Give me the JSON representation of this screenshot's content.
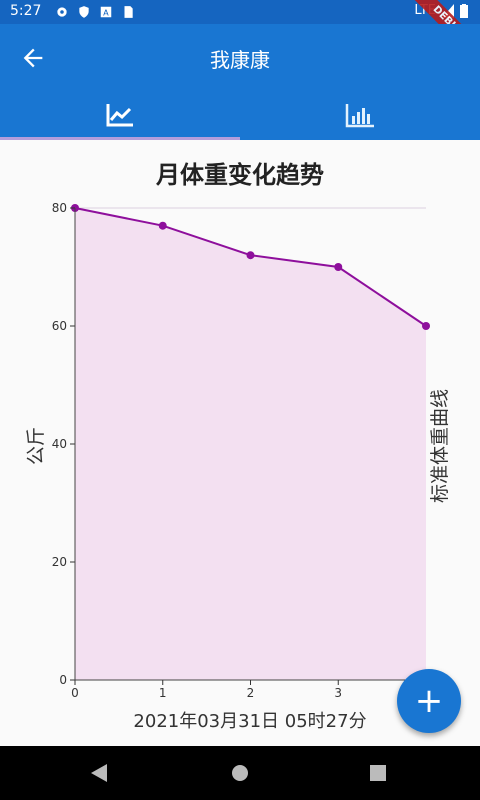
{
  "status_bar": {
    "time": "5:27",
    "network": "LTE",
    "debug_label": "DEBUG"
  },
  "app_bar": {
    "title": "我康康",
    "back_icon": "arrow-back-icon"
  },
  "tabs": [
    {
      "icon": "line-chart-icon",
      "selected": true
    },
    {
      "icon": "bar-chart-icon",
      "selected": false
    }
  ],
  "colors": {
    "primary": "#1976d2",
    "status": "#1565c0",
    "line": "#8e0f9c",
    "fill": "#f3e0f1"
  },
  "chart_data": {
    "type": "area",
    "title": "月体重变化趋势",
    "ylabel": "公斤",
    "series_label": "标准体重曲线",
    "xlabel": "2021年03月31日 05时27分",
    "x": [
      0,
      1,
      2,
      3,
      4
    ],
    "x_tick_labels": [
      "0",
      "1",
      "2",
      "3"
    ],
    "y": [
      80,
      77,
      72,
      70,
      60
    ],
    "y_ticks": [
      "0",
      "20",
      "40",
      "60",
      "80"
    ],
    "ylim": [
      0,
      80
    ],
    "xlim": [
      0,
      4
    ],
    "grid": true
  },
  "fab": {
    "label": "+"
  }
}
